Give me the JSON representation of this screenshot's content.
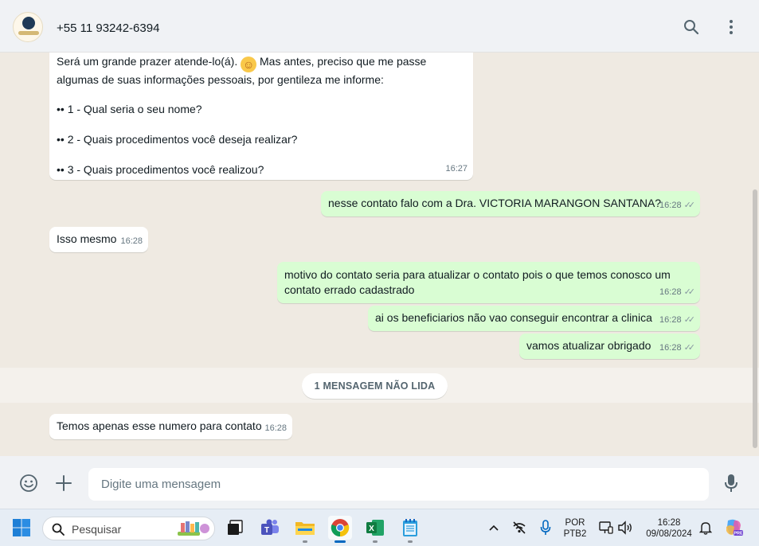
{
  "header": {
    "contact_name": "+55 11 93242-6394"
  },
  "messages": [
    {
      "direction": "in",
      "text": "Será um grande prazer atende-lo(á).",
      "emoji": "☺",
      "text_after_emoji": " Mas antes, preciso que me passe",
      "line2": "algumas de suas informações pessoais, por gentileza me informe:",
      "items": [
        "•• 1 - Qual seria o seu nome?",
        "•• 2 - Quais procedimentos você deseja realizar?",
        "•• 3 - Quais procedimentos você realizou?"
      ],
      "time": "16:27"
    },
    {
      "direction": "out",
      "text": "nesse contato falo com a Dra. VICTORIA MARANGON SANTANA?",
      "time": "16:28"
    },
    {
      "direction": "in",
      "text": "Isso mesmo",
      "time": "16:28"
    },
    {
      "direction": "out",
      "text": "motivo do contato seria para atualizar o contato pois o que temos conosco um\ncontato errado cadastrado",
      "time": "16:28"
    },
    {
      "direction": "out",
      "text": "ai os beneficiarios não vao conseguir encontrar a clinica",
      "time": "16:28"
    },
    {
      "direction": "out",
      "text": "vamos atualizar obrigado",
      "time": "16:28"
    },
    {
      "direction": "in",
      "text": "Temos apenas esse numero para contato",
      "time": "16:28"
    }
  ],
  "unread_label": "1 MENSAGEM NÃO LIDA",
  "composer": {
    "placeholder": "Digite uma mensagem"
  },
  "taskbar": {
    "search_label": "Pesquisar",
    "language_top": "POR",
    "language_bottom": "PTB2",
    "time": "16:28",
    "date": "09/08/2024"
  },
  "colors": {
    "outgoing_bubble": "#d9fdd3",
    "incoming_bubble": "#ffffff",
    "chat_background": "#efeae2",
    "header_background": "#f0f2f5"
  }
}
